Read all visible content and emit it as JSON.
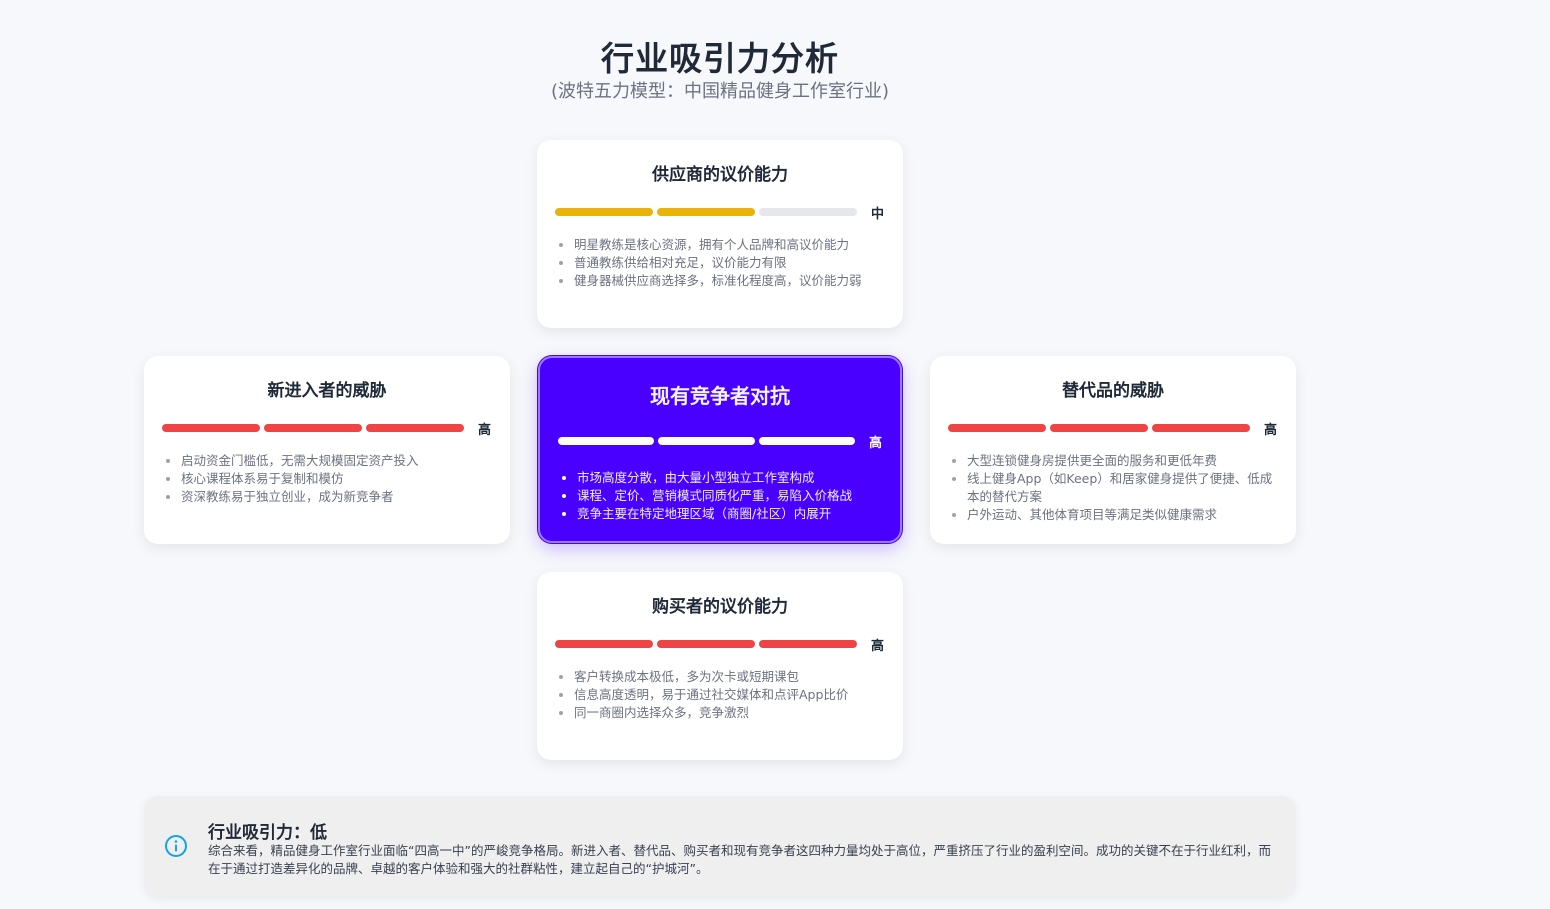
{
  "header": {
    "title": "行业吸引力分析",
    "subtitle": "(波特五力模型：中国精品健身工作室行业)"
  },
  "colors": {
    "high": "#ef4444",
    "medium": "#eab308",
    "empty": "#e5e7eb",
    "center_bar": "#ffffff",
    "center_bg": "#4a00ff"
  },
  "forces": {
    "supplier": {
      "title": "供应商的议价能力",
      "level": "中",
      "level_score": 2,
      "level_max": 3,
      "points": [
        "明星教练是核心资源，拥有个人品牌和高议价能力",
        "普通教练供给相对充足，议价能力有限",
        "健身器械供应商选择多，标准化程度高，议价能力弱"
      ]
    },
    "new_entrants": {
      "title": "新进入者的威胁",
      "level": "高",
      "level_score": 3,
      "level_max": 3,
      "points": [
        "启动资金门槛低，无需大规模固定资产投入",
        "核心课程体系易于复制和模仿",
        "资深教练易于独立创业，成为新竞争者"
      ]
    },
    "rivalry": {
      "title": "现有竞争者对抗",
      "level": "高",
      "level_score": 3,
      "level_max": 3,
      "points": [
        "市场高度分散，由大量小型独立工作室构成",
        "课程、定价、营销模式同质化严重，易陷入价格战",
        "竞争主要在特定地理区域（商圈/社区）内展开"
      ]
    },
    "substitutes": {
      "title": "替代品的威胁",
      "level": "高",
      "level_score": 3,
      "level_max": 3,
      "points": [
        "大型连锁健身房提供更全面的服务和更低年费",
        "线上健身App（如Keep）和居家健身提供了便捷、低成本的替代方案",
        "户外运动、其他体育项目等满足类似健康需求"
      ]
    },
    "buyers": {
      "title": "购买者的议价能力",
      "level": "高",
      "level_score": 3,
      "level_max": 3,
      "points": [
        "客户转换成本极低，多为次卡或短期课包",
        "信息高度透明，易于通过社交媒体和点评App比价",
        "同一商圈内选择众多，竞争激烈"
      ]
    }
  },
  "summary": {
    "icon": "info-icon",
    "title": "行业吸引力：低",
    "text": "综合来看，精品健身工作室行业面临“四高一中”的严峻竞争格局。新进入者、替代品、购买者和现有竞争者这四种力量均处于高位，严重挤压了行业的盈利空间。成功的关键不在于行业红利，而在于通过打造差异化的品牌、卓越的客户体验和强大的社群粘性，建立起自己的“护城河”。"
  }
}
